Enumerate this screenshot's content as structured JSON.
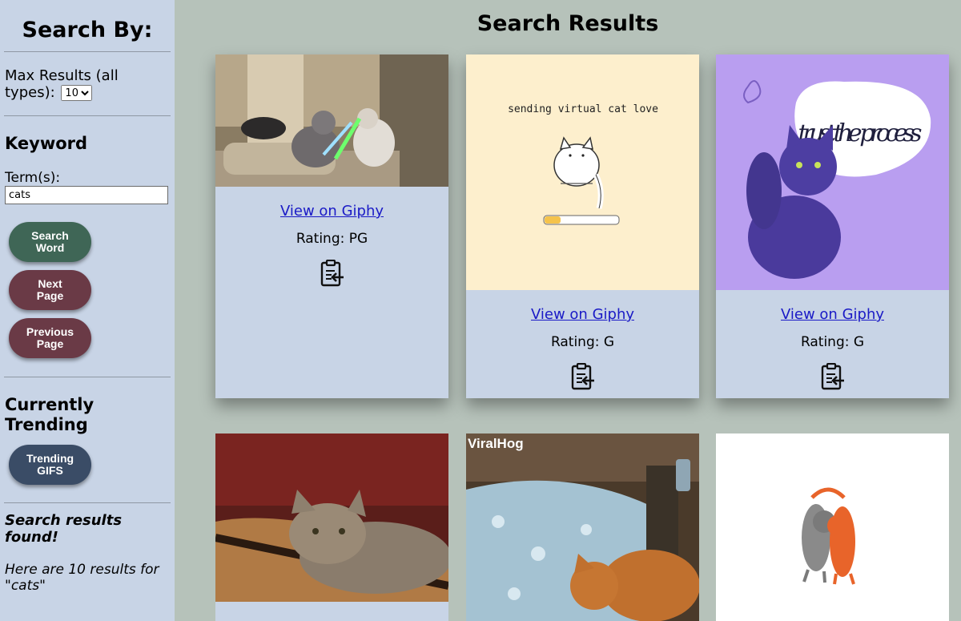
{
  "sidebar": {
    "heading": "Search By:",
    "max_results_label": "Max Results (all types):",
    "max_results_value": "10",
    "keyword_heading": "Keyword",
    "terms_label": "Term(s):",
    "terms_value": "cats",
    "search_word_button": "Search Word",
    "next_page_button": "Next Page",
    "previous_page_button": "Previous Page",
    "trending_heading": "Currently Trending",
    "trending_button": "Trending GIFS",
    "found_text": "Search results found!",
    "results_text": "Here are 10 results for \"cats\""
  },
  "main": {
    "title": "Search Results",
    "cards": [
      {
        "link": "View on Giphy",
        "rating": "Rating: PG",
        "image": "cats lightsaber duel gif"
      },
      {
        "link": "View on Giphy",
        "rating": "Rating: G",
        "image": "sending virtual cat love gif",
        "caption": "sending virtual cat love"
      },
      {
        "link": "View on Giphy",
        "rating": "Rating: G",
        "image": "trust the process cat gif",
        "caption": "trust the process"
      },
      {
        "image": "cat on guitar gif"
      },
      {
        "image": "viralhog cat in bed gif",
        "watermark": "ViralHog"
      },
      {
        "image": "two hugging cats gif"
      }
    ]
  },
  "colors": {
    "page_bg": "#b6c2ba",
    "sidebar_bg": "#c8d4e6",
    "search_button": "#3f6656",
    "page_buttons": "#6a3a46",
    "trending_button": "#3a4c66",
    "link": "#1a1ac6"
  },
  "icons": [
    "clipboard-copy-icon",
    "select-chevron-icon"
  ]
}
